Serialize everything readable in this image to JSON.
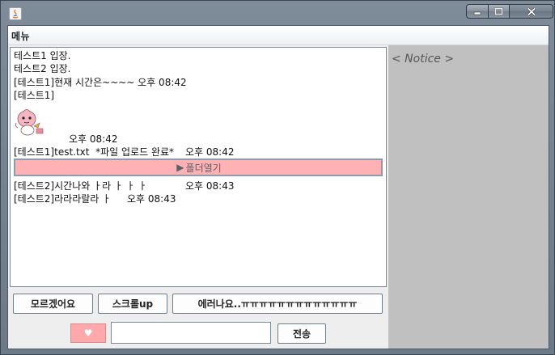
{
  "window": {
    "controls": {
      "minimize": "minimize-icon",
      "maximize": "maximize-icon",
      "close": "close-icon"
    }
  },
  "menu": {
    "label": "메뉴"
  },
  "chat": {
    "lines": [
      "테스트1 입장.",
      "테스트2 입장.",
      "[테스트1]현재 시간은~~~~ 오후 08:42",
      "[테스트1]",
      "오후 08:42",
      "[테스트1]test.txt  *파일 업로드 완료*",
      "오후 08:42",
      "[테스트2]시간나와 ㅏ라 ㅏ ㅏ ㅏ",
      "오후 08:43",
      "[테스트2]라라라랄라 ㅏ",
      "오후 08:43"
    ],
    "folder_button": {
      "arrow": "▶",
      "label": "폴더열기"
    }
  },
  "notice": {
    "title": "< Notice >"
  },
  "quick_buttons": [
    "모르겠어요",
    "스크롤up",
    "에러나요..ㅠㅠㅠㅠㅠㅠㅠㅠㅠㅠㅠㅠㅠ"
  ],
  "input": {
    "emoji_button_icon": "♥",
    "value": "",
    "send_label": "전송"
  },
  "colors": {
    "accent_pink": "#ffb1b4",
    "notice_bg": "#c0c0c0"
  }
}
